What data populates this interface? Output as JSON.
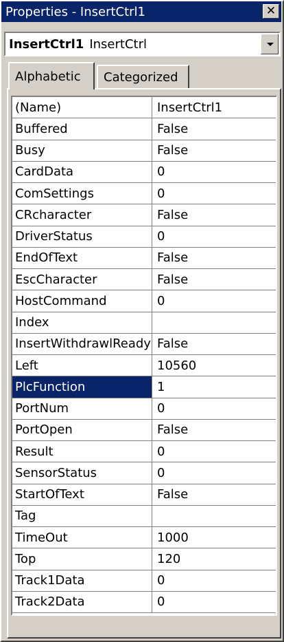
{
  "window": {
    "title": "Properties - InsertCtrl1",
    "close_glyph": "✕"
  },
  "object_selector": {
    "name": "InsertCtrl1",
    "type": "InsertCtrl"
  },
  "tabs": [
    {
      "label": "Alphabetic",
      "active": true
    },
    {
      "label": "Categorized",
      "active": false
    }
  ],
  "properties": [
    {
      "name": "(Name)",
      "value": "InsertCtrl1"
    },
    {
      "name": "Buffered",
      "value": "False"
    },
    {
      "name": "Busy",
      "value": "False"
    },
    {
      "name": "CardData",
      "value": "0"
    },
    {
      "name": "ComSettings",
      "value": "0"
    },
    {
      "name": "CRcharacter",
      "value": "False"
    },
    {
      "name": "DriverStatus",
      "value": "0"
    },
    {
      "name": "EndOfText",
      "value": "False"
    },
    {
      "name": "EscCharacter",
      "value": "False"
    },
    {
      "name": "HostCommand",
      "value": "0"
    },
    {
      "name": "Index",
      "value": ""
    },
    {
      "name": "InsertWithdrawlReady",
      "value": "False"
    },
    {
      "name": "Left",
      "value": "10560"
    },
    {
      "name": "PlcFunction",
      "value": "1"
    },
    {
      "name": "PortNum",
      "value": "0"
    },
    {
      "name": "PortOpen",
      "value": "False"
    },
    {
      "name": "Result",
      "value": "0"
    },
    {
      "name": "SensorStatus",
      "value": "0"
    },
    {
      "name": "StartOfText",
      "value": "False"
    },
    {
      "name": "Tag",
      "value": ""
    },
    {
      "name": "TimeOut",
      "value": "1000"
    },
    {
      "name": "Top",
      "value": "120"
    },
    {
      "name": "Track1Data",
      "value": "0"
    },
    {
      "name": "Track2Data",
      "value": "0"
    }
  ],
  "selected_property": "PlcFunction",
  "colors": {
    "titlebar": "#0a246a",
    "face": "#d4d0c8",
    "selection": "#0a246a"
  }
}
